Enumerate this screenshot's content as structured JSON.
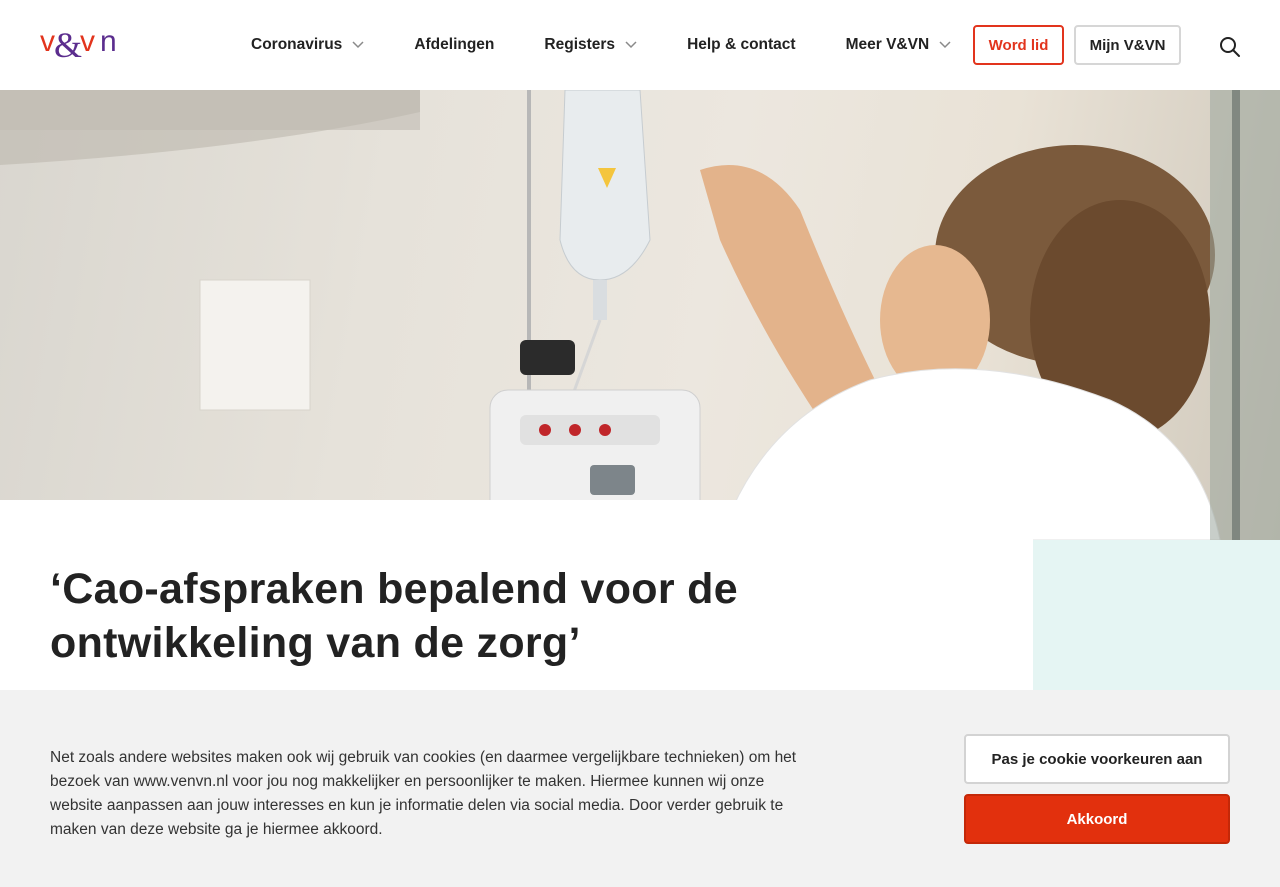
{
  "brand": {
    "logo_alt": "v&vn",
    "accent": "#e2341d",
    "secondary": "#5b2d8e"
  },
  "nav": {
    "items": [
      {
        "label": "Coronavirus",
        "has_dropdown": true
      },
      {
        "label": "Afdelingen",
        "has_dropdown": false
      },
      {
        "label": "Registers",
        "has_dropdown": true
      },
      {
        "label": "Help & contact",
        "has_dropdown": false
      },
      {
        "label": "Meer V&VN",
        "has_dropdown": true
      }
    ],
    "word_lid": "Word lid",
    "mijn": "Mijn V&VN",
    "search_icon": "search-icon"
  },
  "hero": {
    "image_subject": "nurse preparing IV drip"
  },
  "article": {
    "title": "‘Cao-afspraken bepalend voor de ontwikkeling van de zorg’"
  },
  "cookie": {
    "text": "Net zoals andere websites maken ook wij gebruik van cookies (en daarmee vergelijkbare technieken) om het bezoek van www.venvn.nl voor jou nog makkelijker en persoonlijker te maken. Hiermee kunnen wij onze website aanpassen aan jouw interesses en kun je informatie delen via social media. Door verder gebruik te maken van deze website ga je hiermee akkoord.",
    "prefs_button": "Pas je cookie voorkeuren aan",
    "accept_button": "Akkoord",
    "accept_color": "#e2300d"
  }
}
